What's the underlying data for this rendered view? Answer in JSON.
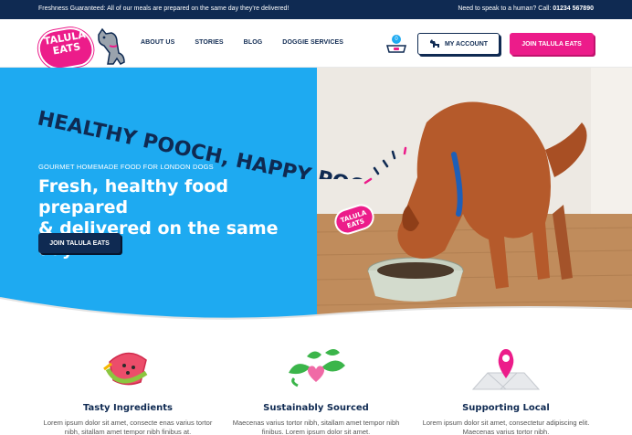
{
  "topbar": {
    "message": "Freshness Guaranteed: All of our meals are prepared on the same day they’re delivered!",
    "help_text": "Need to speak to a human? Call: ",
    "phone": "01234 567890"
  },
  "brand": {
    "logo_text": "TALULA EATS",
    "primary_color": "#0f2a52",
    "accent_color": "#ec1c8a",
    "hero_color": "#1eaaf1"
  },
  "nav": {
    "items": [
      {
        "label": "ABOUT US"
      },
      {
        "label": "STORIES"
      },
      {
        "label": "BLOG"
      },
      {
        "label": "DOGGIE SERVICES"
      }
    ],
    "cart_icon": "dog-bowl-icon",
    "cart_count": "0",
    "account_label": "MY ACCOUNT",
    "account_icon": "dog-icon",
    "join_label": "JOIN TALULA EATS"
  },
  "hero": {
    "slogan": "HEALTHY POOCH, HAPPY POOCH",
    "eyebrow": "GOURMET HOMEMADE FOOD FOR LONDON DOGS",
    "headline_line1": "Fresh, healthy food prepared",
    "headline_line2": "& delivered on the same day.",
    "cta_label": "JOIN TALULA EATS",
    "image_icon": "puppy-eating-photo",
    "bowl_label": "TALULA EATS"
  },
  "features": [
    {
      "icon": "watermelon-icon",
      "title": "Tasty Ingredients",
      "body": "Lorem ipsum dolor sit amet, consecte enas varius tortor nibh, sitallam amet tempor nibh finibus at."
    },
    {
      "icon": "heart-leaves-icon",
      "title": "Sustainably Sourced",
      "body": "Maecenas varius tortor nibh, sitallam amet tempor nibh finibus. Lorem ipsum dolor sit amet."
    },
    {
      "icon": "map-pin-icon",
      "title": "Supporting Local",
      "body": "Lorem ipsum dolor sit amet, consectetur adipiscing elit. Maecenas varius tortor nibh."
    }
  ]
}
